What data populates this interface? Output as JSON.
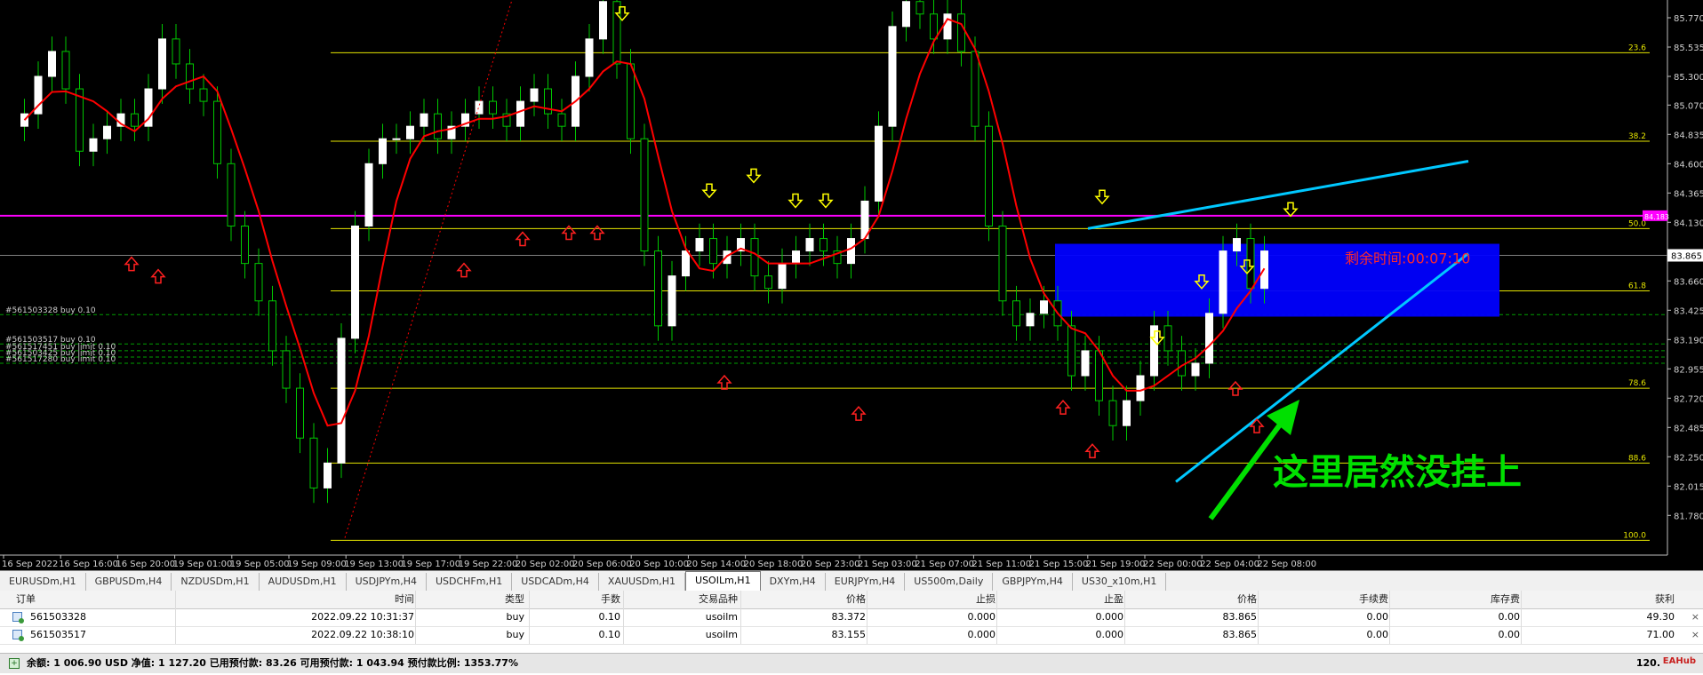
{
  "chart": {
    "price_levels": [
      "85.770",
      "85.535",
      "85.300",
      "85.070",
      "84.835",
      "84.600",
      "84.365",
      "84.130",
      "83.865",
      "83.660",
      "83.425",
      "83.190",
      "82.955",
      "82.720",
      "82.485",
      "82.250",
      "82.015",
      "81.780"
    ],
    "time_labels": [
      "16 Sep 2022",
      "16 Sep 16:00",
      "16 Sep 20:00",
      "19 Sep 01:00",
      "19 Sep 05:00",
      "19 Sep 09:00",
      "19 Sep 13:00",
      "19 Sep 17:00",
      "19 Sep 22:00",
      "20 Sep 02:00",
      "20 Sep 06:00",
      "20 Sep 10:00",
      "20 Sep 14:00",
      "20 Sep 18:00",
      "20 Sep 23:00",
      "21 Sep 03:00",
      "21 Sep 07:00",
      "21 Sep 11:00",
      "21 Sep 15:00",
      "21 Sep 19:00",
      "22 Sep 00:00",
      "22 Sep 04:00",
      "22 Sep 08:00"
    ],
    "fib_levels": [
      "23.6",
      "38.2",
      "50.0",
      "61.8",
      "78.6",
      "88.6",
      "100.0"
    ],
    "current_price": "83.865",
    "horizontal_line_price": "84.183",
    "order_labels": [
      "#561503328 buy 0.10",
      "#561503517 buy 0.10",
      "#561517451 buy limit 0.10",
      "#561503425 buy limit 0.10",
      "#561517280 buy limit 0.10"
    ],
    "countdown_text": "剩余时间:00:07:10",
    "annotation_text": "这里居然没挂上",
    "colors": {
      "bull": "#ffffff",
      "bear": "#00c800",
      "ma": "#ff0000",
      "fib": "#e6e600",
      "magenta": "#ff00ff",
      "trend": "#00c8ff",
      "box": "#0000ff",
      "arrow_note": "#00e000"
    }
  },
  "tabs": [
    "EURUSDm,H1",
    "GBPUSDm,H4",
    "NZDUSDm,H1",
    "AUDUSDm,H1",
    "USDJPYm,H4",
    "USDCHFm,H1",
    "USDCADm,H4",
    "XAUUSDm,H1",
    "USOILm,H1",
    "DXYm,H4",
    "EURJPYm,H4",
    "US500m,Daily",
    "GBPJPYm,H4",
    "US30_x10m,H1"
  ],
  "active_tab": "USOILm,H1",
  "terminal": {
    "headers": [
      "订单",
      "时间",
      "类型",
      "手数",
      "交易品种",
      "价格",
      "止损",
      "止盈",
      "价格",
      "手续费",
      "库存费",
      "获利"
    ],
    "rows": [
      [
        "561503328",
        "2022.09.22 10:31:37",
        "buy",
        "0.10",
        "usoilm",
        "83.372",
        "0.000",
        "0.000",
        "83.865",
        "0.00",
        "0.00",
        "49.30"
      ],
      [
        "561503517",
        "2022.09.22 10:38:10",
        "buy",
        "0.10",
        "usoilm",
        "83.155",
        "0.000",
        "0.000",
        "83.865",
        "0.00",
        "0.00",
        "71.00"
      ]
    ],
    "footer": "余额: 1 006.90 USD  净值: 1 127.20  已用预付款: 83.26  可用预付款: 1 043.94  预付款比例: 1353.77%",
    "footer_right": "120.",
    "watermark": "EAHub",
    "close_symbol": "×"
  }
}
